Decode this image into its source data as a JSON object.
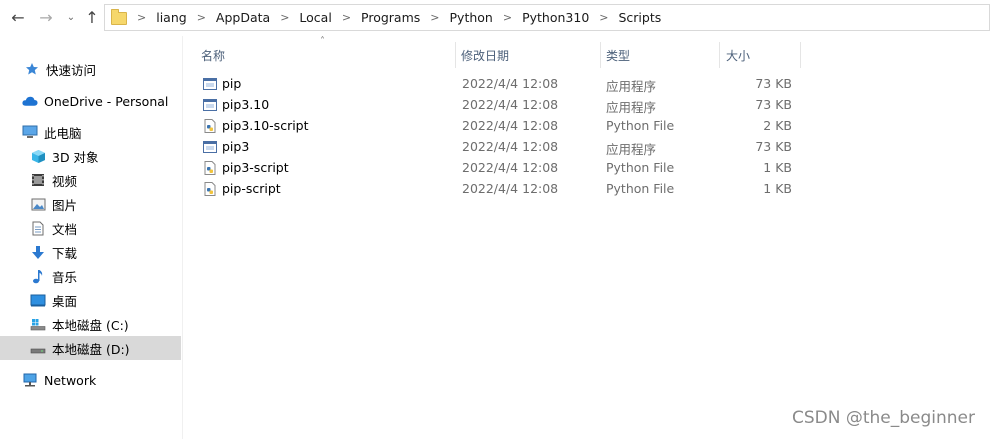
{
  "nav": {
    "back_icon": "arrow-left-icon",
    "forward_icon": "arrow-right-icon",
    "recent_icon": "chevron-down-icon",
    "up_icon": "arrow-up-icon"
  },
  "breadcrumb": [
    "liang",
    "AppData",
    "Local",
    "Programs",
    "Python",
    "Python310",
    "Scripts"
  ],
  "sidebar": [
    {
      "label": "快速访问",
      "icon": "star-icon"
    },
    {
      "label": "OneDrive - Personal",
      "icon": "cloud-icon"
    },
    {
      "label": "此电脑",
      "icon": "computer-icon"
    },
    {
      "label": "3D 对象",
      "icon": "cube-icon"
    },
    {
      "label": "视频",
      "icon": "video-icon"
    },
    {
      "label": "图片",
      "icon": "picture-icon"
    },
    {
      "label": "文档",
      "icon": "document-icon"
    },
    {
      "label": "下载",
      "icon": "download-icon"
    },
    {
      "label": "音乐",
      "icon": "music-icon"
    },
    {
      "label": "桌面",
      "icon": "desktop-icon"
    },
    {
      "label": "本地磁盘 (C:)",
      "icon": "drive-icon"
    },
    {
      "label": "本地磁盘 (D:)",
      "icon": "drive-icon",
      "selected": true
    },
    {
      "label": "Network",
      "icon": "network-icon"
    }
  ],
  "columns": {
    "name": "名称",
    "date": "修改日期",
    "type": "类型",
    "size": "大小"
  },
  "files": [
    {
      "name": "pip",
      "date": "2022/4/4 12:08",
      "type": "应用程序",
      "size": "73 KB",
      "icon": "application-icon"
    },
    {
      "name": "pip3.10",
      "date": "2022/4/4 12:08",
      "type": "应用程序",
      "size": "73 KB",
      "icon": "application-icon"
    },
    {
      "name": "pip3.10-script",
      "date": "2022/4/4 12:08",
      "type": "Python File",
      "size": "2 KB",
      "icon": "python-file-icon"
    },
    {
      "name": "pip3",
      "date": "2022/4/4 12:08",
      "type": "应用程序",
      "size": "73 KB",
      "icon": "application-icon"
    },
    {
      "name": "pip3-script",
      "date": "2022/4/4 12:08",
      "type": "Python File",
      "size": "1 KB",
      "icon": "python-file-icon"
    },
    {
      "name": "pip-script",
      "date": "2022/4/4 12:08",
      "type": "Python File",
      "size": "1 KB",
      "icon": "python-file-icon"
    }
  ],
  "watermark": "CSDN @the_beginner"
}
